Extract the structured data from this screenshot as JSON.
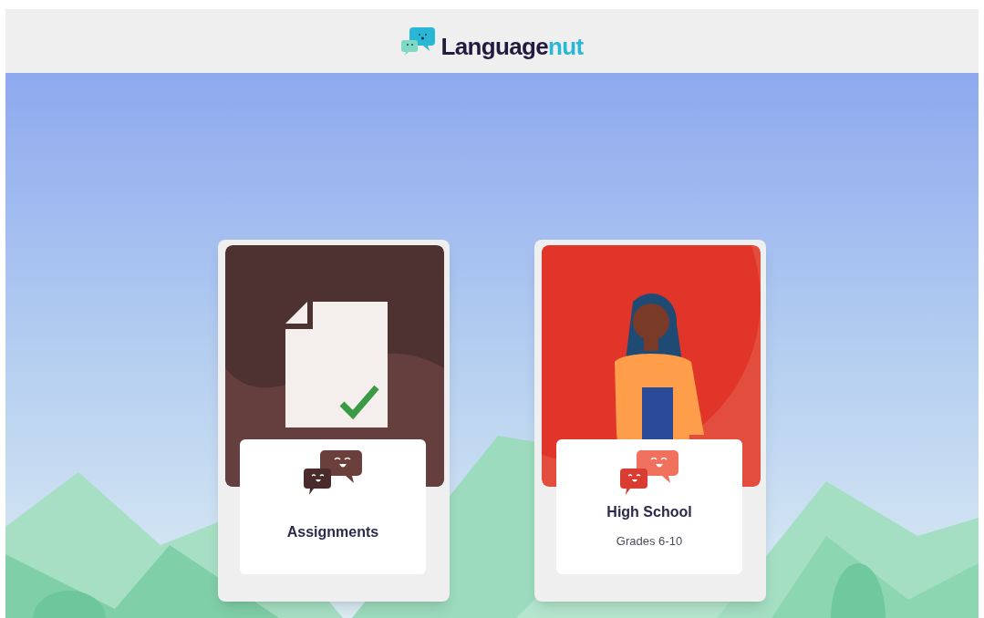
{
  "header": {
    "logo": {
      "parts": [
        "Language",
        "nut"
      ]
    }
  },
  "cards": [
    {
      "kind": "assignments",
      "title": "Assignments"
    },
    {
      "kind": "level",
      "title": "High School",
      "subtitle": "Grades 6-10"
    }
  ]
}
